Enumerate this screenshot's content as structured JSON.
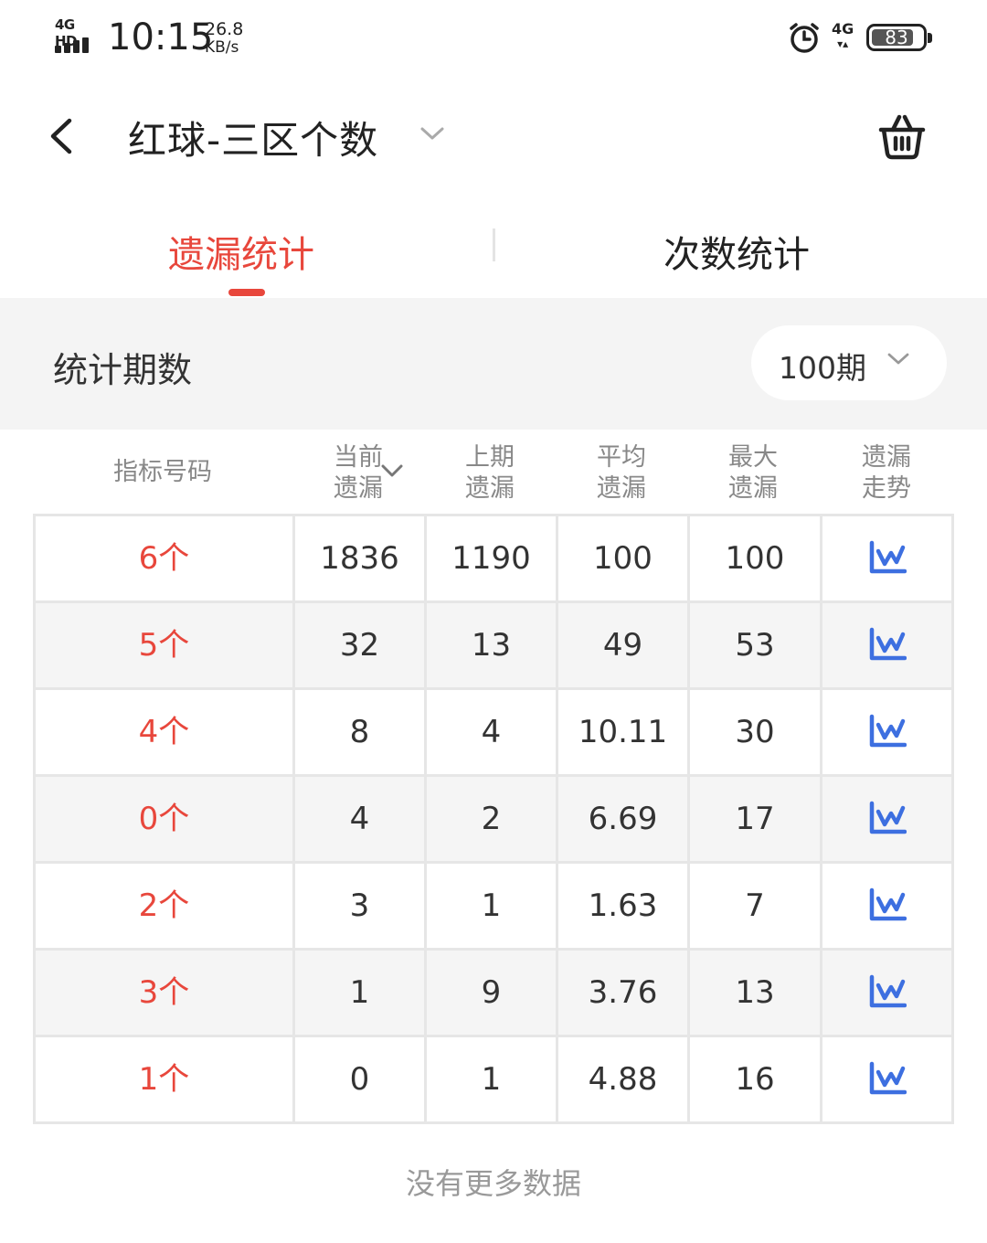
{
  "status_bar": {
    "network": "4G HD",
    "time": "10:15",
    "speed_value": "26.8",
    "speed_unit": "KB/s",
    "network_right": "4G",
    "battery": "83",
    "battery_level": 0.83
  },
  "header": {
    "title": "红球-三区个数",
    "back_icon": "chevron-left-icon",
    "title_dropdown_icon": "chevron-down-icon",
    "cart_icon": "shopping-basket-icon"
  },
  "tabs": [
    {
      "label": "遗漏统计",
      "active": true
    },
    {
      "label": "次数统计",
      "active": false
    }
  ],
  "period": {
    "label": "统计期数",
    "selected": "100期"
  },
  "table": {
    "headers": {
      "code": "指标号码",
      "current_line1": "当前",
      "current_line2": "遗漏",
      "prev_line1": "上期",
      "prev_line2": "遗漏",
      "avg_line1": "平均",
      "avg_line2": "遗漏",
      "max_line1": "最大",
      "max_line2": "遗漏",
      "trend_line1": "遗漏",
      "trend_line2": "走势"
    },
    "rows": [
      {
        "code": "6个",
        "current": "1836",
        "prev": "1190",
        "avg": "100",
        "max": "100"
      },
      {
        "code": "5个",
        "current": "32",
        "prev": "13",
        "avg": "49",
        "max": "53"
      },
      {
        "code": "4个",
        "current": "8",
        "prev": "4",
        "avg": "10.11",
        "max": "30"
      },
      {
        "code": "0个",
        "current": "4",
        "prev": "2",
        "avg": "6.69",
        "max": "17"
      },
      {
        "code": "2个",
        "current": "3",
        "prev": "1",
        "avg": "1.63",
        "max": "7"
      },
      {
        "code": "3个",
        "current": "1",
        "prev": "9",
        "avg": "3.76",
        "max": "13"
      },
      {
        "code": "1个",
        "current": "0",
        "prev": "1",
        "avg": "4.88",
        "max": "16"
      }
    ]
  },
  "footer": {
    "no_more": "没有更多数据"
  },
  "colors": {
    "accent": "#e8473c",
    "trend_icon": "#3d6fe0"
  }
}
